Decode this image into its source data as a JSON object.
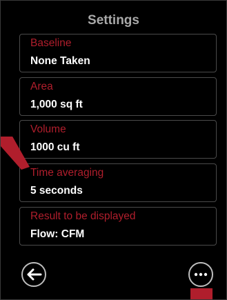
{
  "screen": {
    "title": "Settings"
  },
  "settings": [
    {
      "label": "Baseline",
      "value": "None Taken"
    },
    {
      "label": "Area",
      "value": "1,000 sq ft"
    },
    {
      "label": "Volume",
      "value": "1000 cu ft"
    },
    {
      "label": "Time averaging",
      "value": "5 seconds"
    },
    {
      "label": "Result to be displayed",
      "value": "Flow: CFM"
    }
  ],
  "footer": {
    "back_icon": "arrow-left-icon",
    "more_icon": "ellipsis-icon"
  },
  "colors": {
    "background": "#000000",
    "label": "#b01e2c",
    "value": "#ffffff",
    "title": "#a9a9a9",
    "border": "#4b4b4b",
    "marker": "#b01e2c"
  }
}
